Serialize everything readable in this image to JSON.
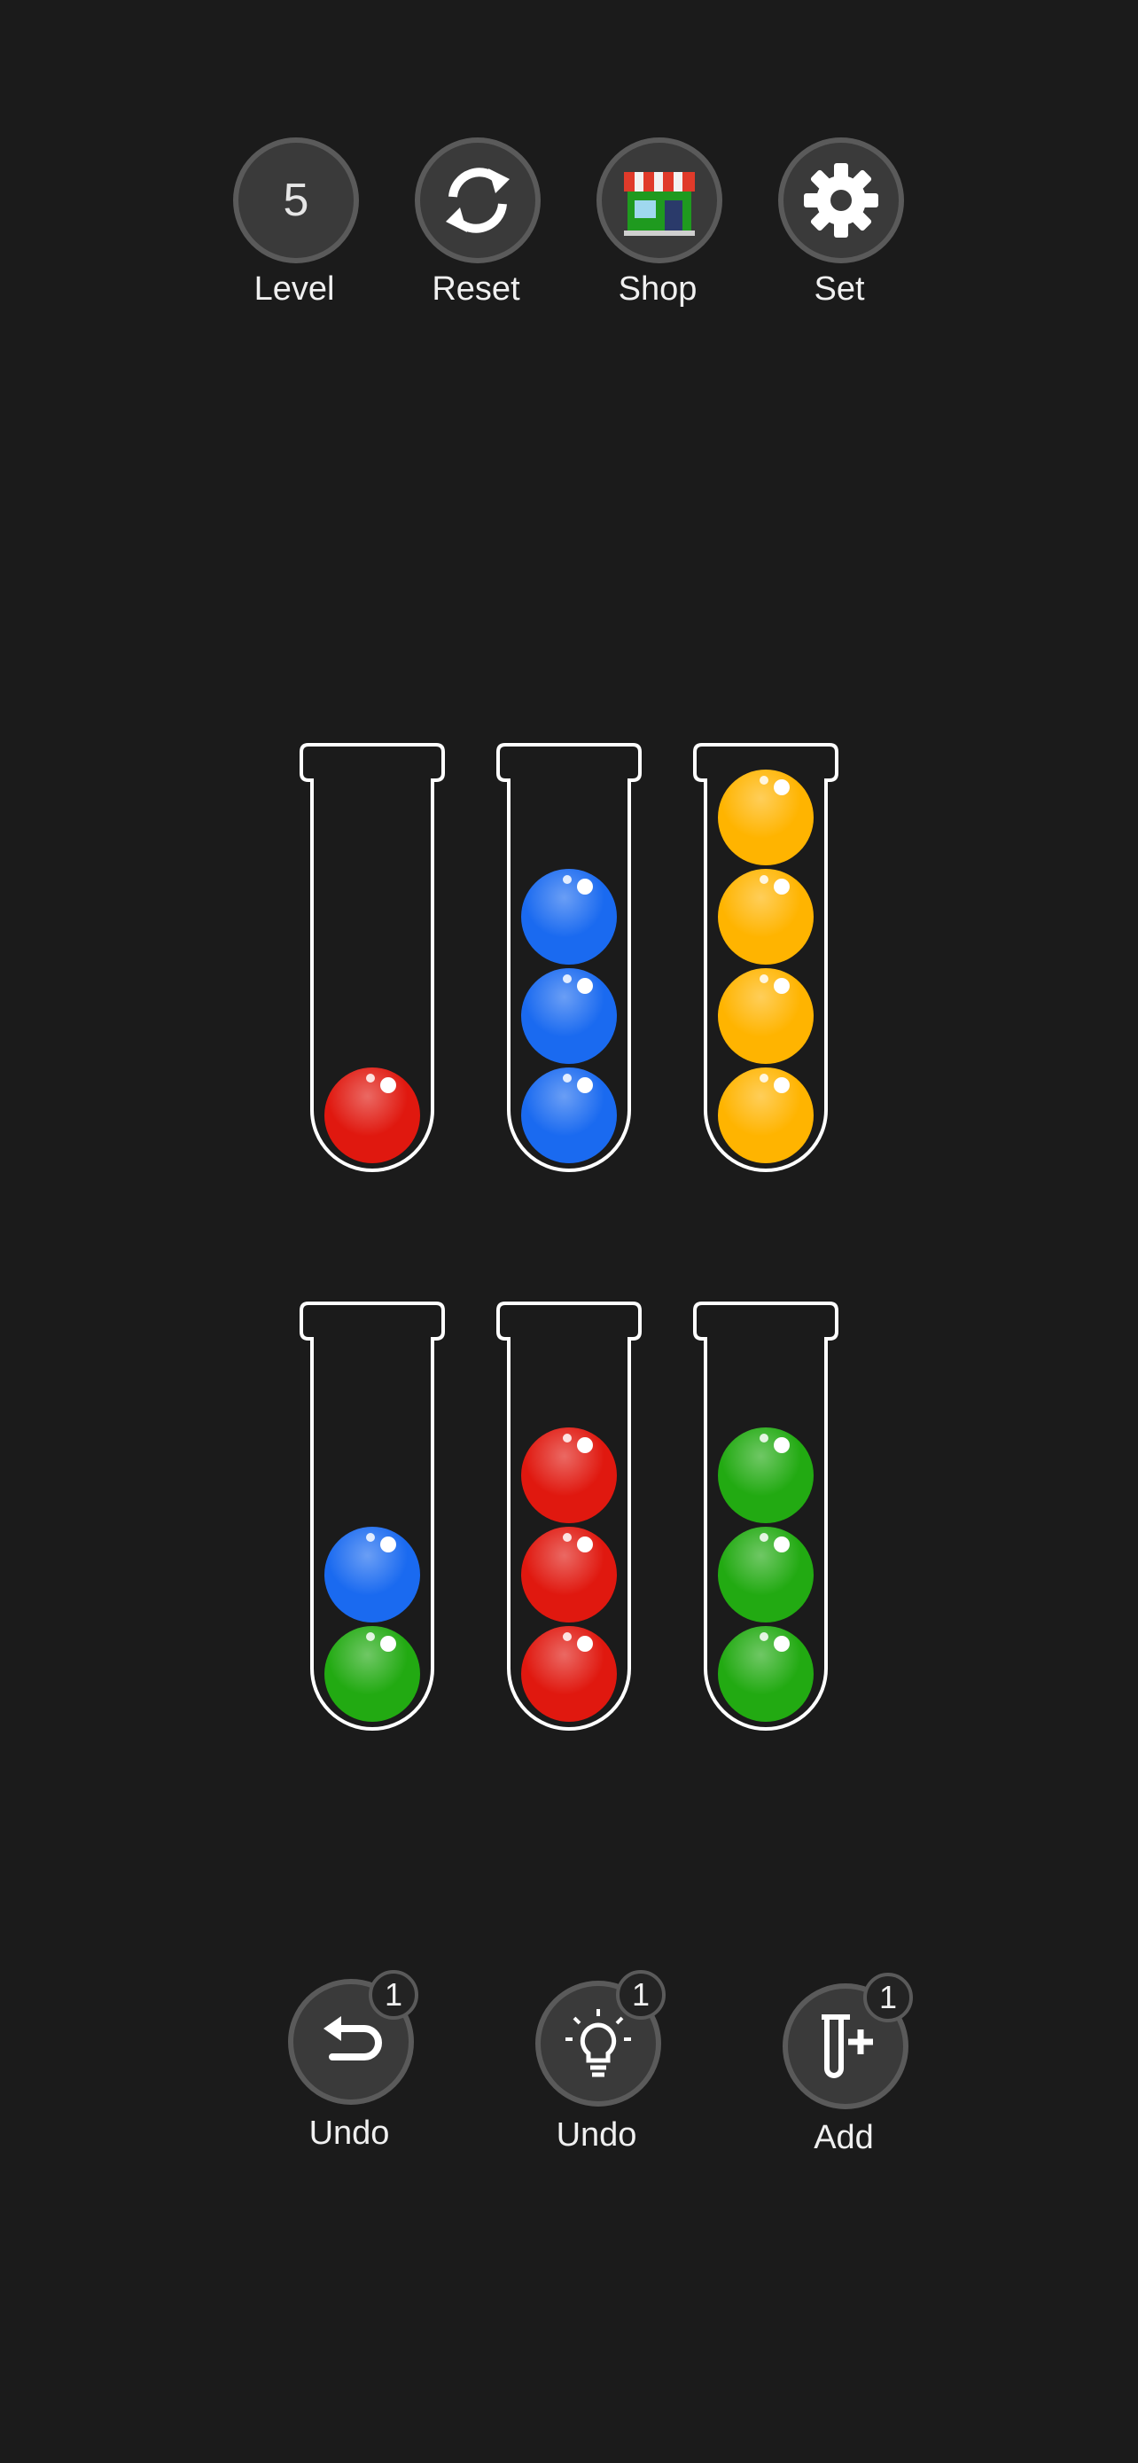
{
  "top_bar": {
    "level": {
      "value": "5",
      "label": "Level",
      "icon": "level-number"
    },
    "reset": {
      "label": "Reset",
      "icon": "refresh-icon"
    },
    "shop": {
      "label": "Shop",
      "icon": "shop-icon"
    },
    "settings": {
      "label": "Set",
      "icon": "gear-icon"
    }
  },
  "colors": {
    "red": "#e0180f",
    "blue": "#1a6af0",
    "yellow": "#ffb400",
    "green": "#22aa12",
    "background": "#1b1b1b",
    "button_bg": "#3a3a3a"
  },
  "tubes": [
    {
      "balls": [
        "red"
      ]
    },
    {
      "balls": [
        "blue",
        "blue",
        "blue"
      ]
    },
    {
      "balls": [
        "yellow",
        "yellow",
        "yellow",
        "yellow"
      ]
    },
    {
      "balls": [
        "green",
        "blue"
      ]
    },
    {
      "balls": [
        "red",
        "red",
        "red"
      ]
    },
    {
      "balls": [
        "green",
        "green",
        "green"
      ]
    }
  ],
  "tube_capacity": 4,
  "bottom_bar": {
    "undo": {
      "label": "Undo",
      "count": "1",
      "icon": "undo-arrow-icon"
    },
    "hint": {
      "label": "Undo",
      "count": "1",
      "icon": "lightbulb-icon"
    },
    "add_tube": {
      "label": "Add",
      "count": "1",
      "icon": "add-tube-icon"
    }
  }
}
